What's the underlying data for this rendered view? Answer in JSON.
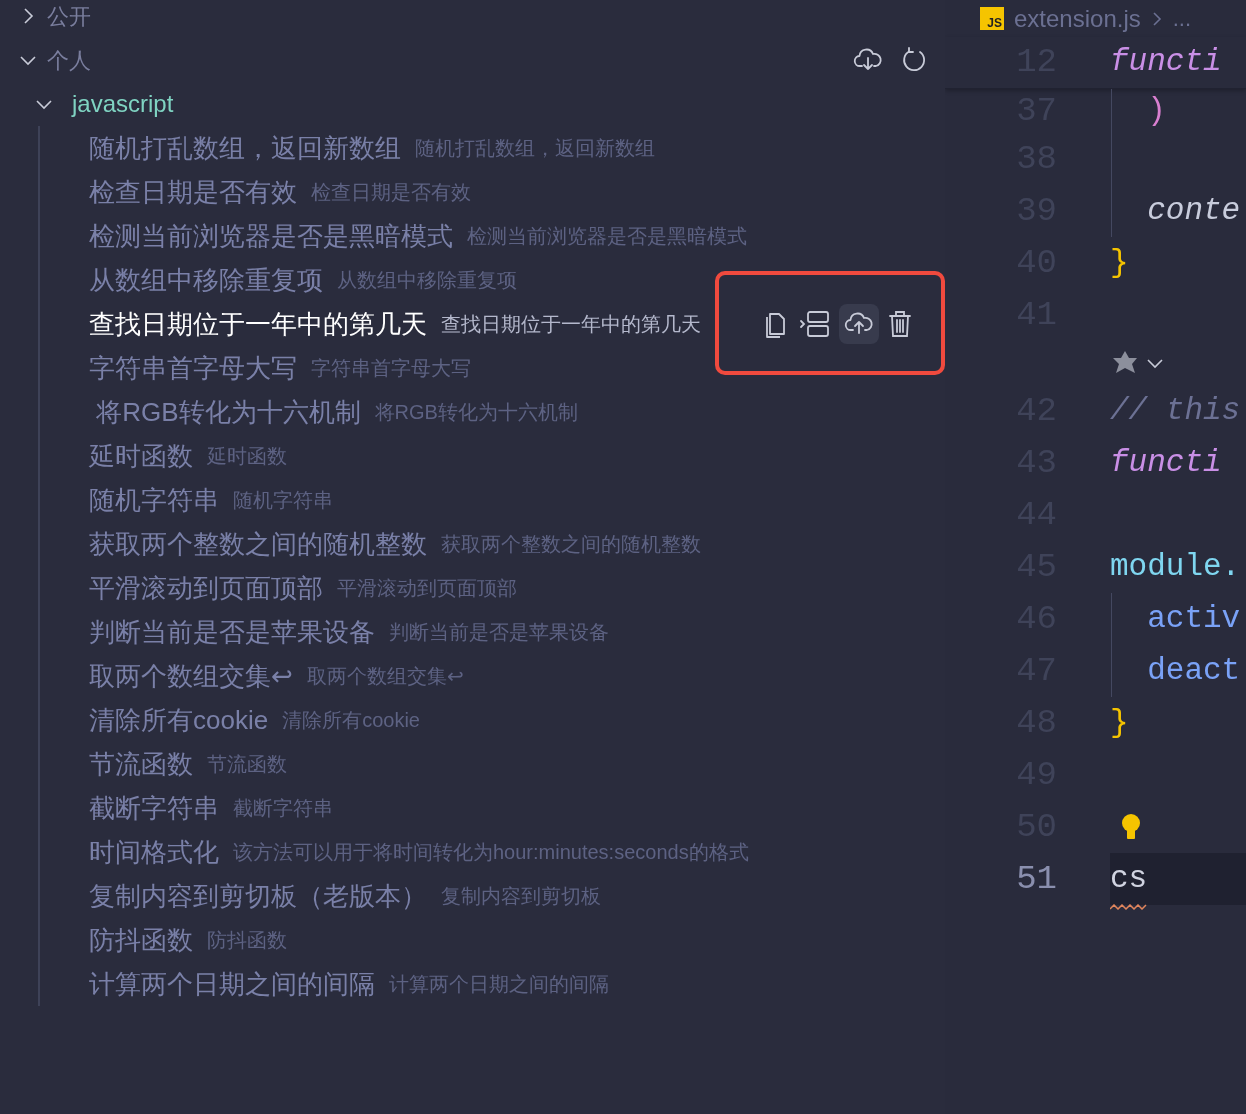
{
  "sections": [
    {
      "label": "公开",
      "expanded": false,
      "toolbar": false
    },
    {
      "label": "个人",
      "expanded": true,
      "toolbar": true
    }
  ],
  "folder": {
    "label": "javascript",
    "expanded": true
  },
  "snippets": [
    {
      "title": "随机打乱数组，返回新数组",
      "description": "随机打乱数组，返回新数组",
      "hovered": false
    },
    {
      "title": "检查日期是否有效",
      "description": "检查日期是否有效",
      "hovered": false
    },
    {
      "title": "检测当前浏览器是否是黑暗模式",
      "description": "检测当前浏览器是否是黑暗模式",
      "hovered": false
    },
    {
      "title": "从数组中移除重复项",
      "description": "从数组中移除重复项",
      "hovered": false
    },
    {
      "title": "查找日期位于一年中的第几天",
      "description": "查找日期位于一年中的第几天",
      "hovered": true
    },
    {
      "title": "字符串首字母大写",
      "description": "字符串首字母大写",
      "hovered": false
    },
    {
      "title": " 将RGB转化为十六机制",
      "description": "将RGB转化为十六机制",
      "hovered": false
    },
    {
      "title": "延时函数",
      "description": "延时函数",
      "hovered": false
    },
    {
      "title": "随机字符串",
      "description": "随机字符串",
      "hovered": false
    },
    {
      "title": "获取两个整数之间的随机整数",
      "description": "获取两个整数之间的随机整数",
      "hovered": false
    },
    {
      "title": "平滑滚动到页面顶部",
      "description": "平滑滚动到页面顶部",
      "hovered": false
    },
    {
      "title": "判断当前是否是苹果设备",
      "description": "判断当前是否是苹果设备",
      "hovered": false
    },
    {
      "title": "取两个数组交集↩",
      "description": "取两个数组交集↩",
      "hovered": false
    },
    {
      "title": "清除所有cookie",
      "description": "清除所有cookie",
      "hovered": false
    },
    {
      "title": "节流函数",
      "description": "节流函数",
      "hovered": false
    },
    {
      "title": "截断字符串",
      "description": "截断字符串",
      "hovered": false
    },
    {
      "title": "时间格式化",
      "description": "该方法可以用于将时间转化为hour:minutes:seconds的格式",
      "hovered": false
    },
    {
      "title": "复制内容到剪切板（老版本）",
      "description": "复制内容到剪切板",
      "hovered": false
    },
    {
      "title": "防抖函数",
      "description": "防抖函数",
      "hovered": false
    },
    {
      "title": "计算两个日期之间的间隔",
      "description": "计算两个日期之间的间隔",
      "hovered": false
    }
  ],
  "editor": {
    "breadcrumb": {
      "badge": "JS",
      "file": "extension.js",
      "rest": "..."
    },
    "sticky_line": {
      "number": "12",
      "text": "functi",
      "kind": "keyword"
    },
    "lines": [
      {
        "kind": "paren",
        "number": "37",
        "text": "  )",
        "guide": true,
        "current": false
      },
      {
        "kind": "blank",
        "number": "38",
        "guide": true,
        "current": false
      },
      {
        "kind": "variable",
        "number": "39",
        "text": "  conte",
        "guide": true,
        "current": false
      },
      {
        "kind": "brace",
        "number": "40",
        "text": "}",
        "guide": false,
        "current": false
      },
      {
        "kind": "blank",
        "number": "41",
        "guide": false,
        "current": false
      },
      {
        "kind": "codelens"
      },
      {
        "kind": "comment",
        "number": "42",
        "text": "// this",
        "guide": false,
        "current": false
      },
      {
        "kind": "keyword",
        "number": "43",
        "text": "functi",
        "guide": false,
        "current": false
      },
      {
        "kind": "blank",
        "number": "44",
        "guide": false,
        "current": false
      },
      {
        "kind": "module",
        "number": "45",
        "text": "module.",
        "guide": false,
        "current": false
      },
      {
        "kind": "property",
        "number": "46",
        "text": "  activ",
        "guide": true,
        "current": false
      },
      {
        "kind": "property",
        "number": "47",
        "text": "  deact",
        "guide": true,
        "current": false
      },
      {
        "kind": "brace",
        "number": "48",
        "text": "}",
        "guide": false,
        "current": false
      },
      {
        "kind": "blank",
        "number": "49",
        "guide": false,
        "current": false
      },
      {
        "kind": "lightbulb",
        "number": "50"
      },
      {
        "kind": "plain",
        "number": "51",
        "text": "cs",
        "guide": false,
        "current": true
      }
    ]
  }
}
